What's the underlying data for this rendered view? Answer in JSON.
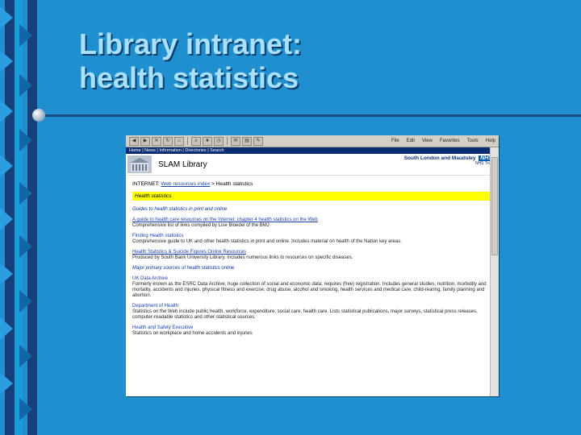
{
  "slide": {
    "title_line1": "Library intranet:",
    "title_line2": "health statistics"
  },
  "browser": {
    "menu": [
      "File",
      "Edit",
      "View",
      "Favorites",
      "Tools",
      "Help"
    ],
    "nav_links": "Home | News | Information | Directories | Search"
  },
  "site": {
    "name": "SLAM Library",
    "trust_name": "South London and Maudsley",
    "nhs_badge": "NHS",
    "trust_sub": "NHS Trust"
  },
  "page": {
    "breadcrumb_prefix": "INTERNET:",
    "breadcrumb_link": "Web resources index",
    "breadcrumb_current": "> Health statistics",
    "heading": "Health statistics",
    "section1": "Guides to health statistics in print and online",
    "entries1": [
      {
        "title": "A guide to health care resources on the Internet: chapter 4 health statistics on the Web",
        "desc": "Comprehensive list of links compiled by Lise Bloedel of the BMJ",
        "link": true
      },
      {
        "title": "Finding Health statistics",
        "desc": "Comprehensive guide to UK and other health statistics in print and online. Includes material on health of the Nation key areas.",
        "link": false
      },
      {
        "title": "Health Statistics & Suicide Figures Online Resources",
        "desc": "Produced by South Bank University Library. Includes numerous links to resources on specific diseases.",
        "link": true
      }
    ],
    "section2": "Major primary sources of health statistics online",
    "entries2": [
      {
        "title": "UK Data Archive",
        "desc": "Formerly known as the ESRC Data Archive, huge collection of social and economic data; requires (free) registration. Includes general studies, nutrition, morbidity and mortality, accidents and injuries, physical fitness and exercise, drug abuse, alcohol and smoking, health services and medical care, child-rearing, family planning and abortion."
      },
      {
        "title": "Department of Health",
        "desc": "Statistics on the Web include public health, workforce, expenditure, social care, health care. Lists statistical publications, major surveys, statistical press releases, computer-readable statistics and other statistical sources."
      },
      {
        "title": "Health and Safety Executive",
        "desc": "Statistics on workplace and home accidents and injuries"
      }
    ]
  }
}
